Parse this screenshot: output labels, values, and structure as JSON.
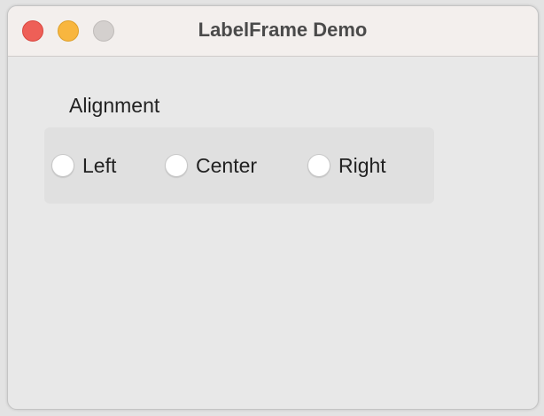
{
  "window": {
    "title": "LabelFrame Demo"
  },
  "labelframe": {
    "label": "Alignment",
    "options": [
      {
        "label": "Left",
        "selected": false
      },
      {
        "label": "Center",
        "selected": false
      },
      {
        "label": "Right",
        "selected": false
      }
    ]
  },
  "colors": {
    "close": "#ee5f57",
    "minimize": "#f8b63f",
    "maximize": "#d4d0ce"
  }
}
